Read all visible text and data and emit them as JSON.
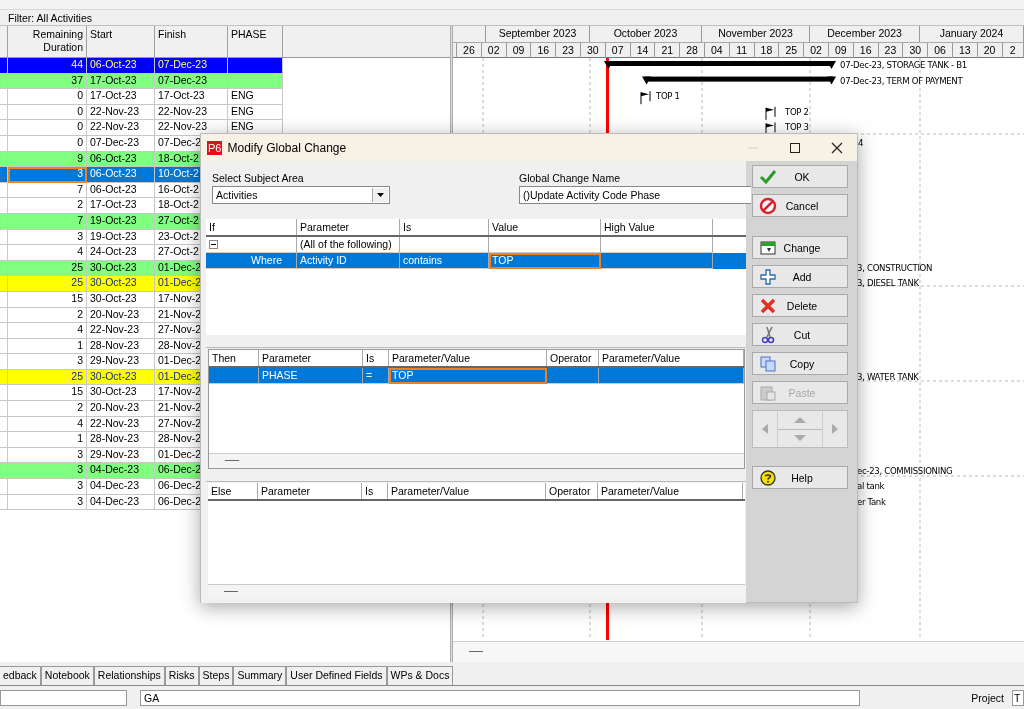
{
  "filter": "Filter: All Activities",
  "table": {
    "columns": [
      "Remaining Duration",
      "Start",
      "Finish",
      "PHASE"
    ],
    "rows": [
      {
        "remaining": "44",
        "start": "06-Oct-23",
        "finish": "07-Dec-23",
        "phase": "",
        "color": "#0000ff",
        "selected": false,
        "bar": {
          "kind": "summary",
          "label": "07-Dec-23, STORAGE TANK - B1"
        }
      },
      {
        "remaining": "37",
        "start": "17-Oct-23",
        "finish": "07-Dec-23",
        "phase": "",
        "color": "#80ff80",
        "selected": false,
        "bar": {
          "kind": "summary",
          "label": "07-Dec-23, TERM OF PAYMENT"
        }
      },
      {
        "remaining": "0",
        "start": "17-Oct-23",
        "finish": "17-Oct-23",
        "phase": "ENG",
        "color": "#ffffff",
        "selected": false,
        "bar": {
          "kind": "milestone",
          "label": "TOP 1"
        }
      },
      {
        "remaining": "0",
        "start": "22-Nov-23",
        "finish": "22-Nov-23",
        "phase": "ENG",
        "color": "#ffffff",
        "selected": false,
        "bar": {
          "kind": "milestone",
          "label": "TOP 2"
        }
      },
      {
        "remaining": "0",
        "start": "22-Nov-23",
        "finish": "22-Nov-23",
        "phase": "ENG",
        "color": "#ffffff",
        "selected": false,
        "bar": {
          "kind": "milestone",
          "label": "TOP 3"
        }
      },
      {
        "remaining": "0",
        "start": "07-Dec-23",
        "finish": "07-Dec-2",
        "phase": "",
        "color": "#ffffff",
        "selected": false,
        "bar": {
          "kind": "label",
          "label": "4"
        }
      },
      {
        "remaining": "9",
        "start": "06-Oct-23",
        "finish": "18-Oct-2",
        "phase": "",
        "color": "#80ff80",
        "selected": false
      },
      {
        "remaining": "3",
        "start": "06-Oct-23",
        "finish": "10-Oct-2",
        "phase": "",
        "color": "#0078d7",
        "selected": true
      },
      {
        "remaining": "7",
        "start": "06-Oct-23",
        "finish": "16-Oct-2",
        "phase": "",
        "color": "#ffffff",
        "selected": false
      },
      {
        "remaining": "2",
        "start": "17-Oct-23",
        "finish": "18-Oct-2",
        "phase": "",
        "color": "#ffffff",
        "selected": false
      },
      {
        "remaining": "7",
        "start": "19-Oct-23",
        "finish": "27-Oct-2",
        "phase": "",
        "color": "#80ff80",
        "selected": false
      },
      {
        "remaining": "3",
        "start": "19-Oct-23",
        "finish": "23-Oct-2",
        "phase": "",
        "color": "#ffffff",
        "selected": false
      },
      {
        "remaining": "4",
        "start": "24-Oct-23",
        "finish": "27-Oct-2",
        "phase": "",
        "color": "#ffffff",
        "selected": false
      },
      {
        "remaining": "25",
        "start": "30-Oct-23",
        "finish": "01-Dec-2",
        "phase": "",
        "color": "#80ff80",
        "selected": false,
        "bar": {
          "kind": "label",
          "label": "3, CONSTRUCTION"
        }
      },
      {
        "remaining": "25",
        "start": "30-Oct-23",
        "finish": "01-Dec-2",
        "phase": "",
        "color": "#ffff00",
        "selected": false,
        "bar": {
          "kind": "label",
          "label": "3, DIESEL TANK"
        }
      },
      {
        "remaining": "15",
        "start": "30-Oct-23",
        "finish": "17-Nov-2",
        "phase": "",
        "color": "#ffffff",
        "selected": false
      },
      {
        "remaining": "2",
        "start": "20-Nov-23",
        "finish": "21-Nov-2",
        "phase": "",
        "color": "#ffffff",
        "selected": false
      },
      {
        "remaining": "4",
        "start": "22-Nov-23",
        "finish": "27-Nov-2",
        "phase": "",
        "color": "#ffffff",
        "selected": false
      },
      {
        "remaining": "1",
        "start": "28-Nov-23",
        "finish": "28-Nov-2",
        "phase": "",
        "color": "#ffffff",
        "selected": false
      },
      {
        "remaining": "3",
        "start": "29-Nov-23",
        "finish": "01-Dec-2",
        "phase": "",
        "color": "#ffffff",
        "selected": false
      },
      {
        "remaining": "25",
        "start": "30-Oct-23",
        "finish": "01-Dec-2",
        "phase": "",
        "color": "#ffff00",
        "selected": false,
        "bar": {
          "kind": "label",
          "label": "3, WATER TANK"
        }
      },
      {
        "remaining": "15",
        "start": "30-Oct-23",
        "finish": "17-Nov-2",
        "phase": "",
        "color": "#ffffff",
        "selected": false
      },
      {
        "remaining": "2",
        "start": "20-Nov-23",
        "finish": "21-Nov-2",
        "phase": "",
        "color": "#ffffff",
        "selected": false
      },
      {
        "remaining": "4",
        "start": "22-Nov-23",
        "finish": "27-Nov-2",
        "phase": "",
        "color": "#ffffff",
        "selected": false
      },
      {
        "remaining": "1",
        "start": "28-Nov-23",
        "finish": "28-Nov-2",
        "phase": "",
        "color": "#ffffff",
        "selected": false
      },
      {
        "remaining": "3",
        "start": "29-Nov-23",
        "finish": "01-Dec-2",
        "phase": "",
        "color": "#ffffff",
        "selected": false
      },
      {
        "remaining": "3",
        "start": "04-Dec-23",
        "finish": "06-Dec-2",
        "phase": "",
        "color": "#80ff80",
        "selected": false,
        "bar": {
          "kind": "label",
          "label": "ec-23, COMMISSIONING"
        }
      },
      {
        "remaining": "3",
        "start": "04-Dec-23",
        "finish": "06-Dec-2",
        "phase": "",
        "color": "#ffffff",
        "selected": false,
        "bar": {
          "kind": "label",
          "label": "al tank"
        }
      },
      {
        "remaining": "3",
        "start": "04-Dec-23",
        "finish": "06-Dec-2",
        "phase": "",
        "color": "#ffffff",
        "selected": false,
        "bar": {
          "kind": "label",
          "label": "er Tank"
        }
      }
    ]
  },
  "gantt": {
    "months": [
      "September 2023",
      "October 2023",
      "November 2023",
      "December 2023",
      "January 2024"
    ],
    "weeks": [
      "26",
      "02",
      "09",
      "16",
      "23",
      "30",
      "07",
      "14",
      "21",
      "28",
      "04",
      "11",
      "18",
      "25",
      "02",
      "09",
      "16",
      "23",
      "30",
      "06",
      "13",
      "20",
      "2"
    ]
  },
  "dialog": {
    "badge": "P6",
    "title": "Modify Global Change",
    "subject_area": {
      "label": "Select Subject Area",
      "value": "Activities"
    },
    "name_field": {
      "label": "Global Change Name",
      "value": "()Update Activity Code Phase"
    },
    "if_table": {
      "columns": [
        "If",
        "Parameter",
        "Is",
        "Value",
        "High Value"
      ],
      "rows": [
        {
          "kind": "group",
          "expanded": true,
          "selected": false,
          "cells": [
            "",
            "(All of the following)",
            "",
            "",
            ""
          ]
        },
        {
          "kind": "condition",
          "selected": true,
          "cells": [
            "Where",
            "Activity ID",
            "contains",
            "TOP",
            ""
          ]
        }
      ]
    },
    "then_table": {
      "columns": [
        "Then",
        "Parameter",
        "Is",
        "Parameter/Value",
        "Operator",
        "Parameter/Value"
      ],
      "rows": [
        {
          "selected": true,
          "cells": [
            "",
            "PHASE",
            "=",
            "TOP",
            "",
            ""
          ]
        }
      ]
    },
    "else_table": {
      "columns": [
        "Else",
        "Parameter",
        "Is",
        "Parameter/Value",
        "Operator",
        "Parameter/Value"
      ]
    },
    "buttons": [
      {
        "kind": "ok",
        "label": "OK",
        "disabled": false
      },
      {
        "kind": "cancel",
        "label": "Cancel",
        "disabled": false
      },
      {
        "kind": "change",
        "label": "Change",
        "disabled": false
      },
      {
        "kind": "add",
        "label": "Add",
        "disabled": false
      },
      {
        "kind": "delete",
        "label": "Delete",
        "disabled": false
      },
      {
        "kind": "cut",
        "label": "Cut",
        "disabled": false
      },
      {
        "kind": "copy",
        "label": "Copy",
        "disabled": false
      },
      {
        "kind": "paste",
        "label": "Paste",
        "disabled": true
      },
      {
        "kind": "arrows"
      },
      {
        "kind": "help",
        "label": "Help",
        "disabled": false
      }
    ]
  },
  "bottom_tabs": [
    "edback",
    "Notebook",
    "Relationships",
    "Risks",
    "Steps",
    "Summary",
    "User Defined Fields",
    "WPs & Docs"
  ],
  "bottom_fields": {
    "description": "GA",
    "project_label": "Project",
    "project_value": "T"
  }
}
